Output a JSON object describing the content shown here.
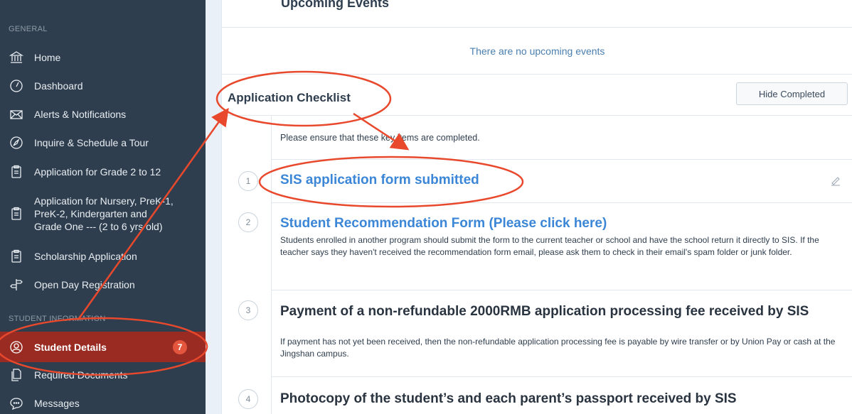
{
  "sidebar": {
    "general_label": "GENERAL",
    "student_info_label": "STUDENT INFORMATION",
    "items": [
      {
        "label": "Home",
        "icon": "bank-icon"
      },
      {
        "label": "Dashboard",
        "icon": "speedometer-icon"
      },
      {
        "label": "Alerts & Notifications",
        "icon": "envelope-icon"
      },
      {
        "label": "Inquire & Schedule a Tour",
        "icon": "compass-icon"
      },
      {
        "label": "Application for Grade 2 to 12",
        "icon": "clipboard-icon"
      },
      {
        "label": "Application for Nursery, PreK-1, PreK-2, Kindergarten and Grade One --- (2 to 6 yrs old)",
        "icon": "clipboard-icon"
      },
      {
        "label": "Scholarship Application",
        "icon": "clipboard-icon"
      },
      {
        "label": "Open Day Registration",
        "icon": "signpost-icon"
      },
      {
        "label": "Student Details",
        "icon": "user-circle-icon",
        "badge": "7"
      },
      {
        "label": "Required Documents",
        "icon": "documents-icon"
      },
      {
        "label": "Messages",
        "icon": "chat-icon"
      }
    ]
  },
  "main": {
    "upcoming_title": "Upcoming Events",
    "no_events": "There are no upcoming events",
    "checklist_title": "Application Checklist",
    "hide_completed": "Hide Completed",
    "ensure_text": "Please ensure that these key items are completed.",
    "steps": [
      {
        "num": "1",
        "title": "SIS application form submitted",
        "desc": ""
      },
      {
        "num": "2",
        "title": "Student Recommendation Form (Please click here)",
        "desc": "Students enrolled in another program should submit the form to the current teacher or school and have the school return it directly to SIS. If the teacher says they haven't received the recommendation form email, please ask them to check in their email's spam folder or junk folder."
      },
      {
        "num": "3",
        "title": "Payment of a non-refundable 2000RMB application processing fee received by SIS",
        "desc": "If payment has not yet been received, then the non-refundable application processing fee is payable by wire transfer or by Union Pay or cash at the Jingshan campus."
      },
      {
        "num": "4",
        "title": "Photocopy of the student’s and each parent’s passport received by SIS",
        "desc": ""
      }
    ]
  },
  "colors": {
    "sidebar_bg": "#2f3e4e",
    "active_bg": "#9a2b22",
    "badge": "#e4553e",
    "link": "#3b86d6",
    "annotation": "#e8482c"
  }
}
